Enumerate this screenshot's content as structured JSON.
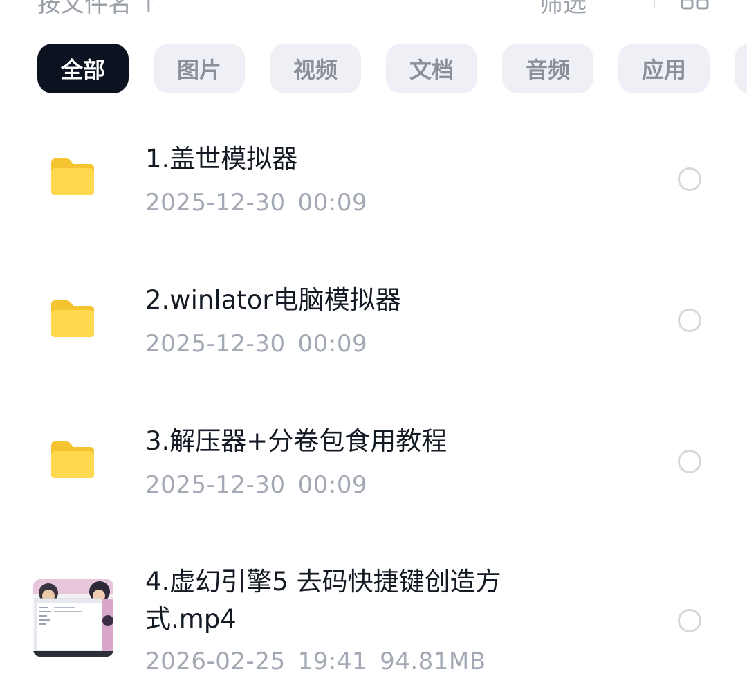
{
  "header": {
    "sort_label": "按文件名 ↑",
    "filter_label": "筛选",
    "grid_icon": "grid-view-icon"
  },
  "chips": [
    {
      "label": "全部",
      "active": true
    },
    {
      "label": "图片",
      "active": false
    },
    {
      "label": "视频",
      "active": false
    },
    {
      "label": "文档",
      "active": false
    },
    {
      "label": "音频",
      "active": false
    },
    {
      "label": "应用",
      "active": false
    }
  ],
  "files": [
    {
      "name": "1.盖世模拟器",
      "date": "2025-12-30",
      "time": "00:09",
      "size": "",
      "type": "folder"
    },
    {
      "name": "2.winlator电脑模拟器",
      "date": "2025-12-30",
      "time": "00:09",
      "size": "",
      "type": "folder"
    },
    {
      "name": "3.解压器+分卷包食用教程",
      "date": "2025-12-30",
      "time": "00:09",
      "size": "",
      "type": "folder"
    },
    {
      "name": "4.虚幻引擎5 去码快捷键创造方式.mp4",
      "date": "2026-02-25",
      "time": "19:41",
      "size": "94.81MB",
      "type": "video"
    }
  ],
  "colors": {
    "folder": "#FFD84D",
    "folder_tab": "#F5C431",
    "active_chip": "#0B1320",
    "chip": "#EEF0F5"
  }
}
